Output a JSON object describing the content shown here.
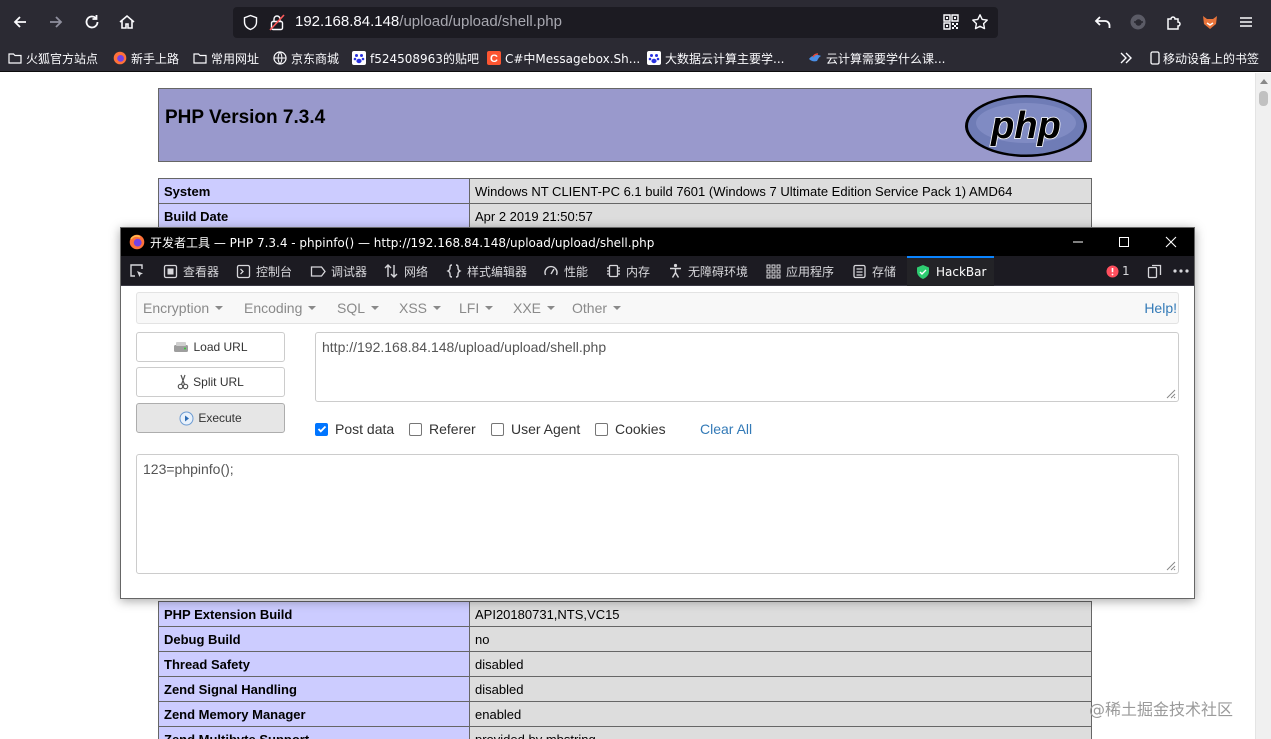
{
  "browser": {
    "url_host": "192.168.84.148",
    "url_path": "/upload/upload/shell.php",
    "bookmarks": [
      {
        "label": "火狐官方站点",
        "icon": "folder-icon"
      },
      {
        "label": "新手上路",
        "icon": "firefox-icon"
      },
      {
        "label": "常用网址",
        "icon": "folder-icon"
      },
      {
        "label": "京东商城",
        "icon": "globe-icon"
      },
      {
        "label": "f524508963的贴吧",
        "icon": "baidu-paw-icon"
      },
      {
        "label": "C#中Messagebox.Sh...",
        "icon": "csdn-icon"
      },
      {
        "label": "大数据云计算主要学...",
        "icon": "baidu-paw-icon"
      },
      {
        "label": "云计算需要学什么课...",
        "icon": "bird-icon"
      }
    ],
    "mobile_bookmarks": "移动设备上的书签"
  },
  "phpinfo": {
    "title": "PHP Version 7.3.4",
    "logo_text": "php",
    "rows_top": [
      {
        "key": "System",
        "value": "Windows NT CLIENT-PC 6.1 build 7601 (Windows 7 Ultimate Edition Service Pack 1) AMD64"
      },
      {
        "key": "Build Date",
        "value": "Apr 2 2019 21:50:57"
      }
    ],
    "rows_bottom": [
      {
        "key": "PHP Extension Build",
        "value": "API20180731,NTS,VC15"
      },
      {
        "key": "Debug Build",
        "value": "no"
      },
      {
        "key": "Thread Safety",
        "value": "disabled"
      },
      {
        "key": "Zend Signal Handling",
        "value": "disabled"
      },
      {
        "key": "Zend Memory Manager",
        "value": "enabled"
      },
      {
        "key": "Zend Multibyte Support",
        "value": "provided by mbstring"
      }
    ]
  },
  "devtools": {
    "title": "开发者工具 — PHP 7.3.4 - phpinfo() — http://192.168.84.148/upload/upload/shell.php",
    "tabs": [
      "查看器",
      "控制台",
      "调试器",
      "网络",
      "样式编辑器",
      "性能",
      "内存",
      "无障碍环境",
      "应用程序",
      "存储",
      "HackBar"
    ],
    "error_count": "1"
  },
  "hackbar": {
    "menu": [
      "Encryption",
      "Encoding",
      "SQL",
      "XSS",
      "LFI",
      "XXE",
      "Other"
    ],
    "help": "Help!",
    "load_url": "Load URL",
    "split_url": "Split URL",
    "execute": "Execute",
    "url_value": "http://192.168.84.148/upload/upload/shell.php",
    "post_data_label": "Post data",
    "post_data_checked": true,
    "referer_label": "Referer",
    "user_agent_label": "User Agent",
    "cookies_label": "Cookies",
    "clear_all": "Clear All",
    "post_body": "123=phpinfo();"
  },
  "watermark": "@稀土掘金技术社区",
  "colors": {
    "chrome_bg": "#2b2a33",
    "urlbar_bg": "#1c1b22",
    "php_header": "#9999cc",
    "php_key": "#ccccff",
    "php_value": "#dddddd",
    "accent": "#0a84ff",
    "link": "#337ab7"
  }
}
